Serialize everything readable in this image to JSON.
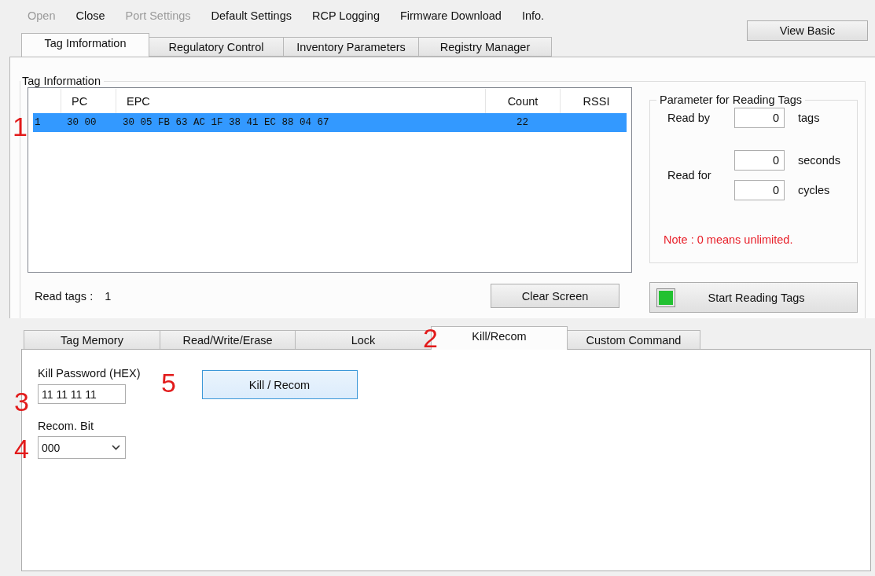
{
  "menu": [
    {
      "label": "Open",
      "disabled": true
    },
    {
      "label": "Close",
      "disabled": false
    },
    {
      "label": "Port Settings",
      "disabled": true
    },
    {
      "label": "Default Settings",
      "disabled": false
    },
    {
      "label": "RCP Logging",
      "disabled": false
    },
    {
      "label": "Firmware Download",
      "disabled": false
    },
    {
      "label": "Info.",
      "disabled": false
    }
  ],
  "view_button": "View Basic",
  "top_tabs": [
    {
      "label": "Tag Imformation",
      "selected": true
    },
    {
      "label": "Regulatory Control",
      "selected": false
    },
    {
      "label": "Inventory Parameters",
      "selected": false
    },
    {
      "label": "Registry Manager",
      "selected": false
    }
  ],
  "tag_information": {
    "title": "Tag Information",
    "table": {
      "columns": [
        "PC",
        "EPC",
        "Count",
        "RSSI"
      ],
      "rows": [
        {
          "index": "1",
          "pc": "30 00",
          "epc": "30 05 FB 63 AC 1F 38 41 EC 88 04 67",
          "count": "22",
          "selected": true
        }
      ]
    },
    "read_tags_label": "Read tags :",
    "read_tags_value": "1",
    "clear_button": "Clear Screen",
    "parameters": {
      "title": "Parameter for Reading Tags",
      "read_by_label": "Read by",
      "read_by_value": "0",
      "read_by_unit": "tags",
      "read_for_label": "Read for",
      "seconds_value": "0",
      "seconds_unit": "seconds",
      "cycles_value": "0",
      "cycles_unit": "cycles",
      "note": "Note : 0 means unlimited."
    },
    "start_button": {
      "label": "Start Reading Tags",
      "indicator_on": true
    }
  },
  "bottom_tabs": [
    {
      "label": "Tag Memory",
      "selected": false
    },
    {
      "label": "Read/Write/Erase",
      "selected": false
    },
    {
      "label": "Lock",
      "selected": false
    },
    {
      "label": "Kill/Recom",
      "selected": true
    },
    {
      "label": "Custom Command",
      "selected": false
    }
  ],
  "kill_recom": {
    "password_label": "Kill Password (HEX)",
    "password_value": "11 11 11 11",
    "kill_button": "Kill / Recom",
    "recom_label": "Recom. Bit",
    "recom_value": "000"
  },
  "callouts": [
    "1",
    "2",
    "3",
    "4",
    "5"
  ]
}
